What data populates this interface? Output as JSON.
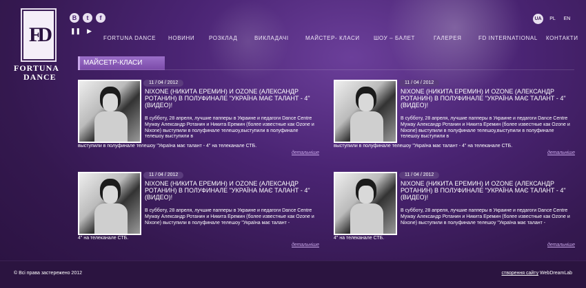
{
  "brand": {
    "line1": "FORTUNA",
    "line2": "DANCE",
    "mark": "FD"
  },
  "social": [
    "В",
    "t",
    "f"
  ],
  "player": {
    "pause": "❚❚",
    "play": "▶"
  },
  "nav": [
    "FORTUNA DANCE",
    "НОВИНИ",
    "РОЗКЛАД",
    "ВИКЛАДАЧІ",
    "МАЙСТЕР- КЛАСИ",
    "ШОУ – БАЛЕТ",
    "ГАЛЕРЕЯ",
    "FD INTERNATIONAL",
    "КОНТАКТИ"
  ],
  "languages": [
    "UA",
    "PL",
    "EN"
  ],
  "section_title": "МАЙСЕТР-КЛАСИ",
  "cards": [
    {
      "date": "11 / 04 / 2012",
      "title": "NIXONE (НИКИТА ЕРЕМИН) И OZONE (АЛЕКСАНДР РОТАНИН) В ПОЛУФИНАЛЕ \"УКРАЇНА МАЄ ТАЛАНТ - 4\" (ВИДЕО)!",
      "text": "В субботу, 28 апреля, лучшие папперы в Украине и педагоги Dance Centre Myway Александр Ротанин и Никита Еремин (более известные как Ozone и Nixone) выступили в полуфинале телешоу,выступили в полуфинале телешоу выступили в",
      "text2": "выступили в полуфинале телешоу \"Україна має талант - 4\" на телеканале СТБ.",
      "more": "детальніше"
    },
    {
      "date": "11 / 04 / 2012",
      "title": "NIXONE (НИКИТА ЕРЕМИН) И OZONE (АЛЕКСАНДР РОТАНИН) В ПОЛУФИНАЛЕ \"УКРАЇНА МАЄ ТАЛАНТ - 4\" (ВИДЕО)!",
      "text": "В субботу, 28 апреля, лучшие папперы в Украине и педагоги Dance Centre Myway Александр Ротанин и Никита Еремин (более известные как Ozone и Nixone) выступили в полуфинале телешоу,выступили в полуфинале телешоу выступили в",
      "text2": "выступили в полуфинале телешоу \"Україна має талант - 4\" на телеканале СТБ.",
      "more": "детальніше"
    },
    {
      "date": "11 / 04 / 2012",
      "title": "NIXONE (НИКИТА ЕРЕМИН) И OZONE (АЛЕКСАНДР РОТАНИН) В ПОЛУФИНАЛЕ \"УКРАЇНА МАЄ ТАЛАНТ - 4\" (ВИДЕО)!",
      "text": "В субботу, 28 апреля, лучшие папперы в Украине и педагоги Dance Centre Myway Александр Ротанин и Никита Еремин (более известные как Ozone и Nixone) выступили в полуфинале телешоу \"Україна має талант -",
      "text2": "4\" на телеканале СТБ.",
      "more": "детальніше"
    },
    {
      "date": "11 / 04 / 2012",
      "title": "NIXONE (НИКИТА ЕРЕМИН) И OZONE (АЛЕКСАНДР РОТАНИН) В ПОЛУФИНАЛЕ \"УКРАЇНА МАЄ ТАЛАНТ - 4\" (ВИДЕО)!",
      "text": "В субботу, 28 апреля, лучшие папперы в Украине и педагоги Dance Centre Myway Александр Ротанин и Никита Еремин (более известные как Ozone и Nixone) выступили в полуфинале телешоу \"Україна має талант -",
      "text2": "4\" на телеканале СТБ.",
      "more": "детальніше"
    }
  ],
  "footer": {
    "copyright": "© Всі права застережено 2012",
    "credit_link": "створення сайту",
    "credit_name": "WebDreamLab"
  }
}
